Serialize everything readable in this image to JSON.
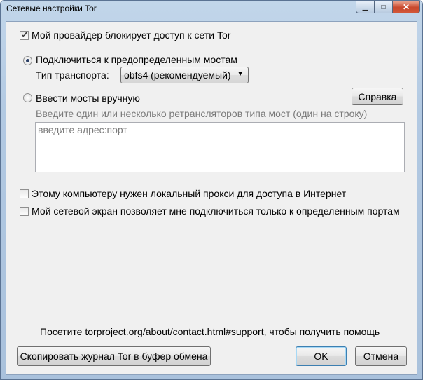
{
  "window": {
    "title": "Сетевые настройки Tor",
    "controls": {
      "minimize": "▁",
      "maximize": "□",
      "close": "✕"
    }
  },
  "bridges": {
    "blocked_checkbox": {
      "label": "Мой провайдер блокирует доступ к сети Tor",
      "checked": true
    },
    "predefined_radio": {
      "label": "Подключиться к предопределенным мостам",
      "selected": true
    },
    "transport_label": "Тип транспорта:",
    "transport_select": {
      "value": "obfs4 (рекомендуемый)"
    },
    "manual_radio": {
      "label": "Ввести мосты вручную",
      "selected": false
    },
    "help_button": "Справка",
    "manual_hint": "Введите один или несколько ретрансляторов типа мост (один на строку)",
    "bridges_textarea": {
      "placeholder": "введите адрес:порт"
    }
  },
  "proxy_checkbox": {
    "label": "Этому компьютеру нужен локальный прокси для доступа в Интернет",
    "checked": false
  },
  "firewall_checkbox": {
    "label": "Мой сетевой экран позволяет мне подключиться только к определенным портам",
    "checked": false
  },
  "help_text": "Посетите torproject.org/about/contact.html#support, чтобы получить помощь",
  "buttons": {
    "copy_log": "Скопировать журнал Tor в буфер обмена",
    "ok": "OK",
    "cancel": "Отмена"
  }
}
